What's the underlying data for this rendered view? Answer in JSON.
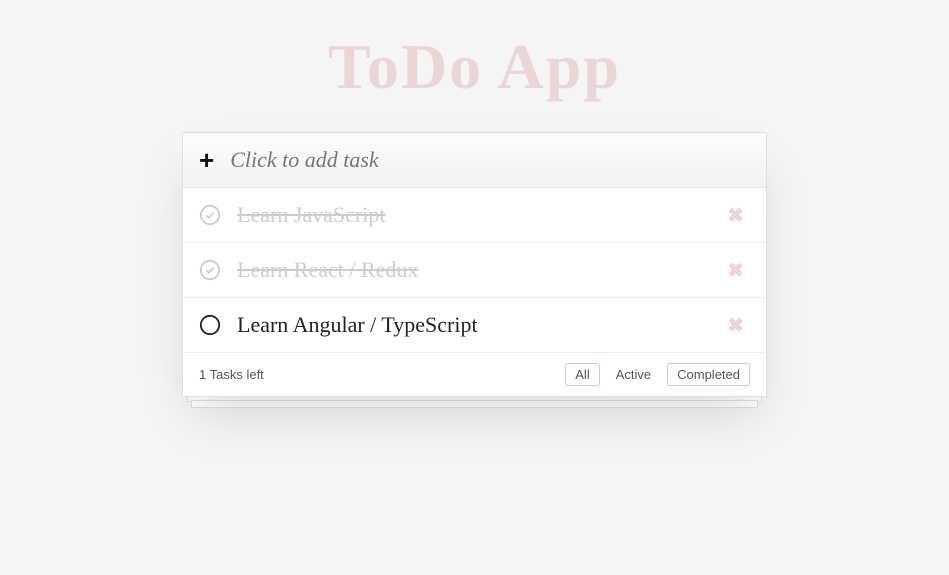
{
  "title": "ToDo App",
  "input_placeholder": "Click to add task",
  "tasks": [
    {
      "text": "Learn JavaScript",
      "completed": true
    },
    {
      "text": "Learn React / Redux",
      "completed": true
    },
    {
      "text": "Learn Angular / TypeScript",
      "completed": false
    }
  ],
  "footer": {
    "tasks_left": "1 Tasks left",
    "filters": {
      "all": "All",
      "active": "Active",
      "completed": "Completed"
    },
    "active_filter": "all"
  }
}
